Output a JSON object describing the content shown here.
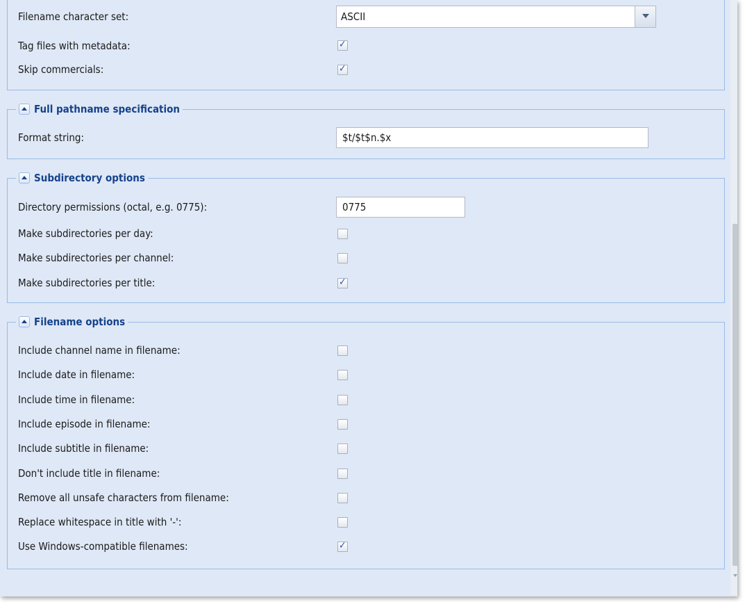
{
  "general": {
    "charset_label": "Filename character set:",
    "charset_value": "ASCII",
    "tag_files_label": "Tag files with metadata:",
    "tag_files_checked": true,
    "skip_commercials_label": "Skip commercials:",
    "skip_commercials_checked": true
  },
  "pathname": {
    "legend": "Full pathname specification",
    "format_label": "Format string:",
    "format_value": "$t/$t$n.$x"
  },
  "subdirectory": {
    "legend": "Subdirectory options",
    "perm_label": "Directory permissions (octal, e.g. 0775):",
    "perm_value": "0775",
    "items": [
      {
        "label": "Make subdirectories per day:",
        "checked": false
      },
      {
        "label": "Make subdirectories per channel:",
        "checked": false
      },
      {
        "label": "Make subdirectories per title:",
        "checked": true
      }
    ]
  },
  "filename": {
    "legend": "Filename options",
    "items": [
      {
        "label": "Include channel name in filename:",
        "checked": false
      },
      {
        "label": "Include date in filename:",
        "checked": false
      },
      {
        "label": "Include time in filename:",
        "checked": false
      },
      {
        "label": "Include episode in filename:",
        "checked": false
      },
      {
        "label": "Include subtitle in filename:",
        "checked": false
      },
      {
        "label": "Don't include title in filename:",
        "checked": false
      },
      {
        "label": "Remove all unsafe characters from filename:",
        "checked": false
      },
      {
        "label": "Replace whitespace in title with '-':",
        "checked": false
      },
      {
        "label": "Use Windows-compatible filenames:",
        "checked": true
      }
    ]
  },
  "icons": {
    "collapse": "chevron-up-icon",
    "dropdown": "chevron-down-icon"
  },
  "colors": {
    "panel_bg": "#dfe8f6",
    "border": "#99bbe8",
    "legend_text": "#15428b",
    "check_mark": "#2a55b5"
  }
}
